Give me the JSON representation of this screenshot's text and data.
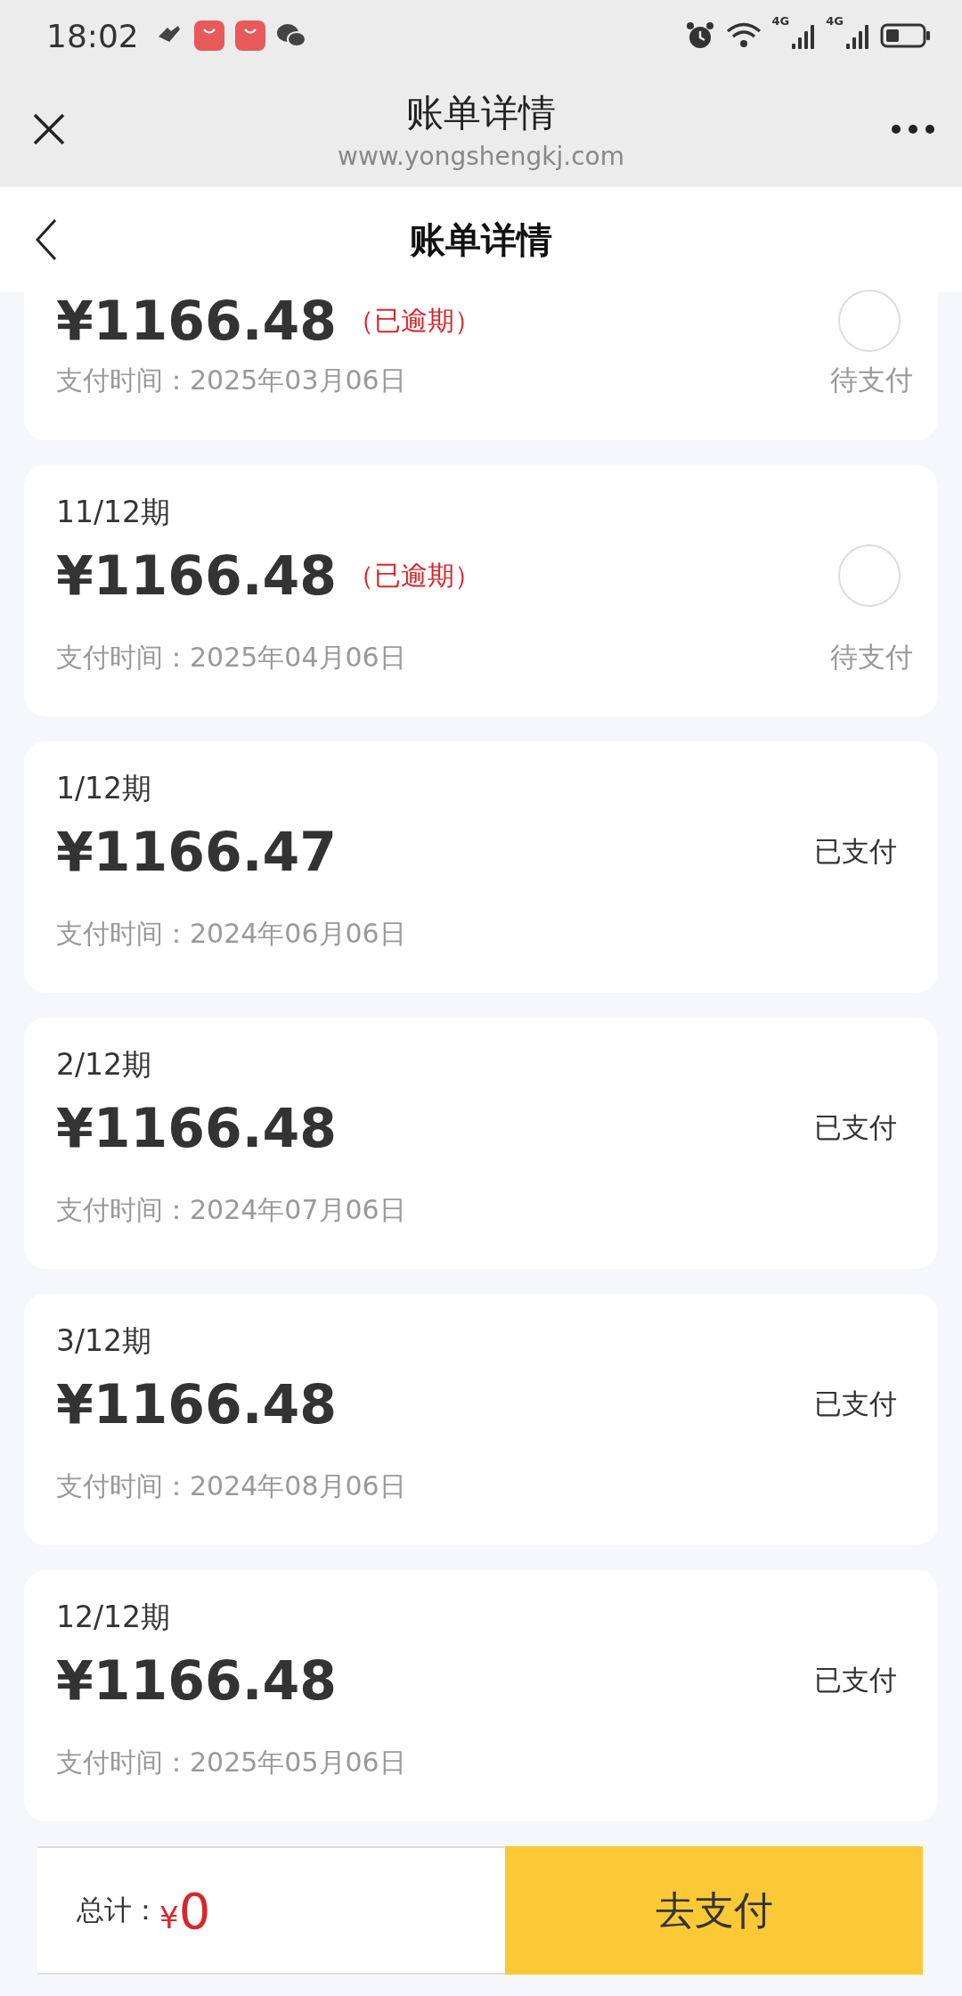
{
  "status_bar": {
    "time": "18:02",
    "network_labels": [
      "4G",
      "4G"
    ]
  },
  "browser_bar": {
    "title": "账单详情",
    "url": "www.yongshengkj.com"
  },
  "page_header": {
    "title": "账单详情"
  },
  "bills": [
    {
      "kind": "pending",
      "amount": "¥1166.48",
      "overdue_label": "（已逾期）",
      "date_label": "支付时间：2025年03月06日",
      "status": "待支付",
      "selected": false
    },
    {
      "kind": "pending",
      "period": "11/12期",
      "amount": "¥1166.48",
      "overdue_label": "（已逾期）",
      "date_label": "支付时间：2025年04月06日",
      "status": "待支付",
      "selected": false
    },
    {
      "kind": "paid",
      "period": "1/12期",
      "amount": "¥1166.47",
      "date_label": "支付时间：2024年06月06日",
      "status": "已支付"
    },
    {
      "kind": "paid",
      "period": "2/12期",
      "amount": "¥1166.48",
      "date_label": "支付时间：2024年07月06日",
      "status": "已支付"
    },
    {
      "kind": "paid",
      "period": "3/12期",
      "amount": "¥1166.48",
      "date_label": "支付时间：2024年08月06日",
      "status": "已支付"
    },
    {
      "kind": "paid",
      "period": "12/12期",
      "amount": "¥1166.48",
      "date_label": "支付时间：2025年05月06日",
      "status": "已支付"
    }
  ],
  "footer": {
    "total_label": "总计：",
    "currency": "¥",
    "total": "0",
    "pay_button": "去支付"
  }
}
